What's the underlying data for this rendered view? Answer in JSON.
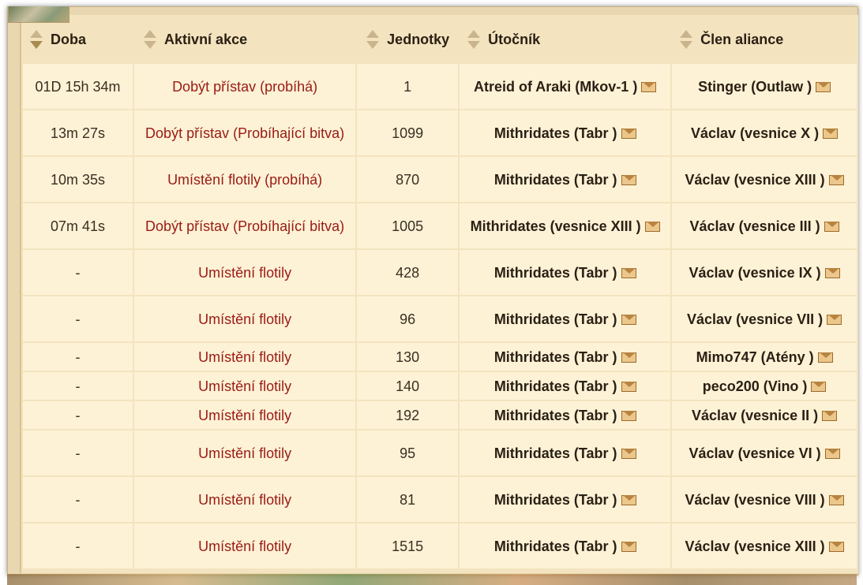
{
  "columns": {
    "time": "Doba",
    "action": "Aktivní akce",
    "units": "Jednotky",
    "attacker": "Útočník",
    "member": "Člen aliance"
  },
  "rows": [
    {
      "time": "01D 15h 34m",
      "action": "Dobýt přístav (probíhá)",
      "units": "1",
      "attacker": "Atreid of Araki (Mkov-1 )",
      "member": "Stinger (Outlaw )"
    },
    {
      "time": "13m 27s",
      "action": "Dobýt přístav (Probíhající bitva)",
      "units": "1099",
      "attacker": "Mithridates (Tabr )",
      "member": "Václav (vesnice X )"
    },
    {
      "time": "10m 35s",
      "action": "Umístění flotily (probíhá)",
      "units": "870",
      "attacker": "Mithridates (Tabr )",
      "member": "Václav (vesnice XIII )"
    },
    {
      "time": "07m 41s",
      "action": "Dobýt přístav (Probíhající bitva)",
      "units": "1005",
      "attacker": "Mithridates (vesnice XIII )",
      "member": "Václav (vesnice III )"
    },
    {
      "time": "-",
      "action": "Umístění flotily",
      "units": "428",
      "attacker": "Mithridates (Tabr )",
      "member": "Václav (vesnice IX )"
    },
    {
      "time": "-",
      "action": "Umístění flotily",
      "units": "96",
      "attacker": "Mithridates (Tabr )",
      "member": "Václav (vesnice VII )"
    },
    {
      "time": "-",
      "action": "Umístění flotily",
      "units": "130",
      "attacker": "Mithridates (Tabr )",
      "member": "Mimo747 (Atény )"
    },
    {
      "time": "-",
      "action": "Umístění flotily",
      "units": "140",
      "attacker": "Mithridates (Tabr )",
      "member": "peco200 (Vino )"
    },
    {
      "time": "-",
      "action": "Umístění flotily",
      "units": "192",
      "attacker": "Mithridates (Tabr )",
      "member": "Václav (vesnice II )"
    },
    {
      "time": "-",
      "action": "Umístění flotily",
      "units": "95",
      "attacker": "Mithridates (Tabr )",
      "member": "Václav (vesnice VI )"
    },
    {
      "time": "-",
      "action": "Umístění flotily",
      "units": "81",
      "attacker": "Mithridates (Tabr )",
      "member": "Václav (vesnice VIII )"
    },
    {
      "time": "-",
      "action": "Umístění flotily",
      "units": "1515",
      "attacker": "Mithridates (Tabr )",
      "member": "Václav (vesnice XIII )"
    }
  ],
  "icons": {
    "sort": "sort-arrows-icon",
    "mail": "envelope-icon"
  }
}
